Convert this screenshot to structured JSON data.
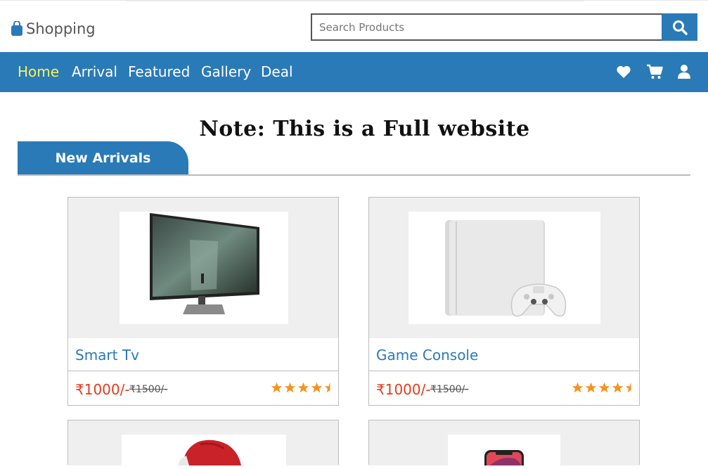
{
  "header": {
    "brand": "Shopping",
    "search_placeholder": "Search Products"
  },
  "nav": {
    "items": [
      {
        "label": "Home",
        "active": true
      },
      {
        "label": "Arrival",
        "active": false
      },
      {
        "label": "Featured",
        "active": false
      },
      {
        "label": "Gallery",
        "active": false
      },
      {
        "label": "Deal",
        "active": false
      }
    ],
    "icons": [
      "heart-icon",
      "cart-icon",
      "user-icon"
    ]
  },
  "note": "Note: This is a Full website",
  "section_tab": "New Arrivals",
  "products": [
    {
      "name": "Smart Tv",
      "price": "₹1000/-",
      "old_price": "₹1500/-",
      "rating": 4.5
    },
    {
      "name": "Game Console",
      "price": "₹1000/-",
      "old_price": "₹1500/-",
      "rating": 4.5
    },
    {
      "name": "",
      "price": "",
      "old_price": "",
      "rating": null
    },
    {
      "name": "",
      "price": "",
      "old_price": "",
      "rating": null
    }
  ],
  "colors": {
    "primary": "#2a7ab8",
    "active_nav": "#f5f55a",
    "price": "#e53a1c",
    "star": "#f5931e"
  }
}
